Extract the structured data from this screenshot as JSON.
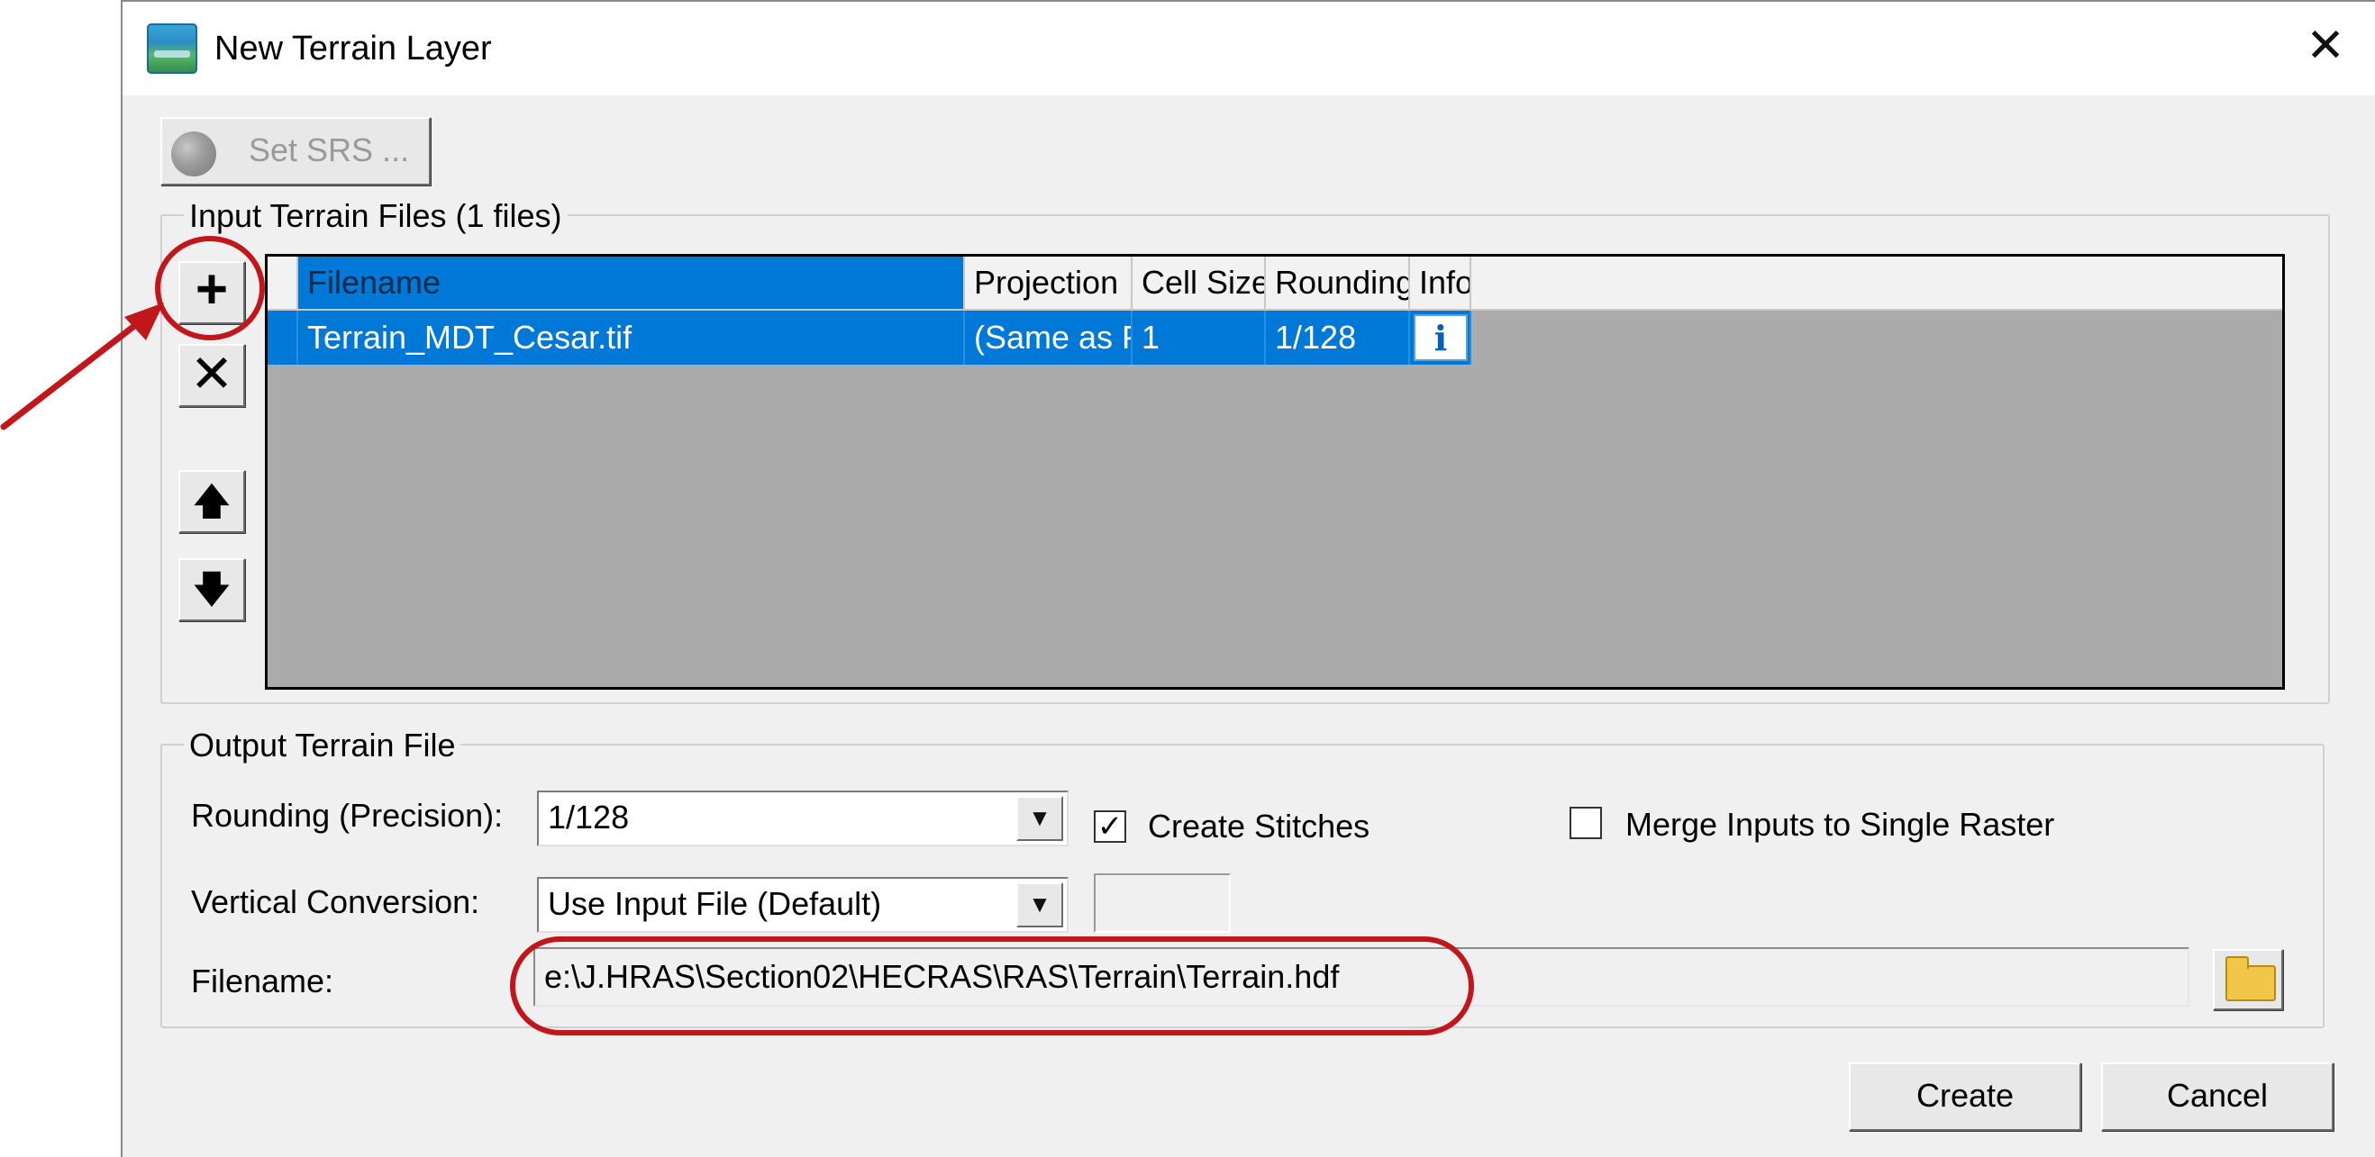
{
  "window": {
    "title": "New Terrain Layer",
    "icon": "terrain-app-icon",
    "close_glyph": "✕"
  },
  "toolbar": {
    "set_srs_label": "Set SRS ...",
    "set_srs_icon": "globe-icon",
    "set_srs_enabled": false
  },
  "input_group": {
    "legend": "Input Terrain Files (1 files)",
    "buttons": {
      "add_glyph": "+",
      "remove_glyph": "✕",
      "up_glyph": "🡅",
      "down_glyph": "🡇"
    },
    "grid": {
      "columns": [
        "Filename",
        "Projection",
        "Cell Size",
        "Rounding",
        "Info"
      ],
      "rows": [
        {
          "filename": "Terrain_MDT_Cesar.tif",
          "projection": "(Same as Project)",
          "cell_size": "1",
          "rounding": "1/128",
          "info_glyph": "i"
        }
      ],
      "selected_row": 0,
      "selection_color": "#0078d7",
      "empty_color": "#ababab"
    }
  },
  "output_group": {
    "legend": "Output Terrain File",
    "rounding_label": "Rounding (Precision):",
    "rounding_value": "1/128",
    "create_stitches_label": "Create Stitches",
    "create_stitches_checked": true,
    "merge_label": "Merge Inputs to Single Raster",
    "merge_checked": false,
    "vertical_label": "Vertical Conversion:",
    "vertical_value": "Use Input File (Default)",
    "vertical_extra_value": "",
    "filename_label": "Filename:",
    "filename_value": "e:\\J.HRAS\\Section02\\HECRAS\\RAS\\Terrain\\Terrain.hdf",
    "browse_icon": "folder-open-icon"
  },
  "footer": {
    "create_label": "Create",
    "cancel_label": "Cancel"
  },
  "annotations": {
    "color": "#c0161c",
    "add_button_circled": true,
    "filename_circled": true,
    "arrow_points_to": "add-file-button"
  }
}
